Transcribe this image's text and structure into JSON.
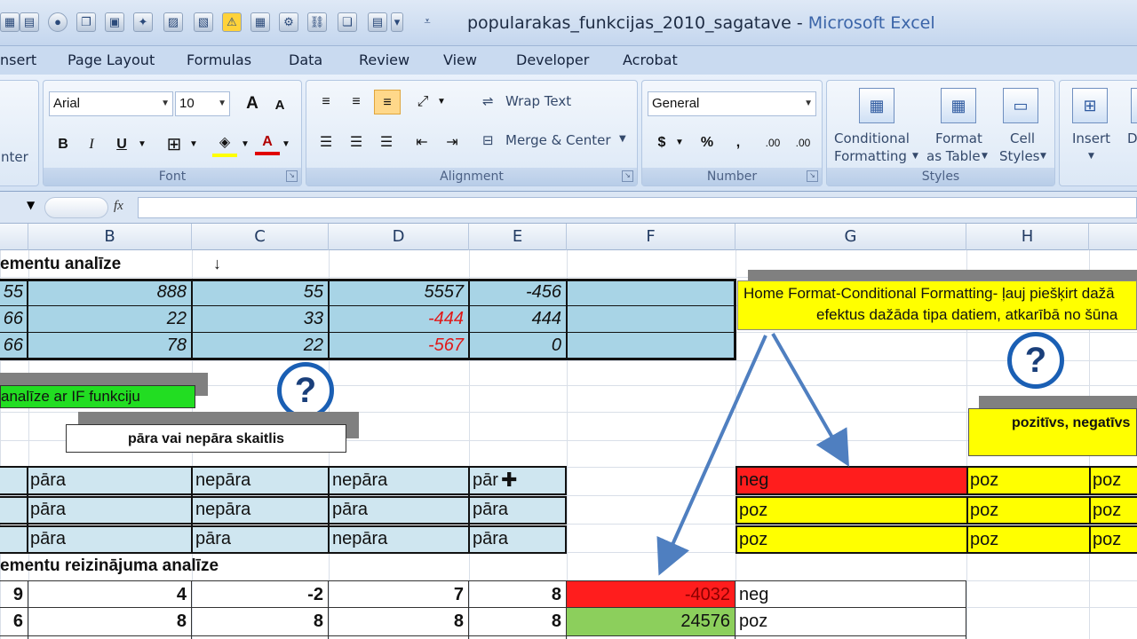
{
  "window": {
    "title": "popularakas_funkcijas_2010_sagatave",
    "separator": "-",
    "app_name": "Microsoft Excel"
  },
  "quick_access_icons": [
    "new-icon",
    "save-icon",
    "undo-icon",
    "print-icon",
    "copy-icon",
    "chart-icon",
    "warning-icon",
    "table-icon",
    "macro-icon",
    "link-icon",
    "dropdown-icon"
  ],
  "tabs": [
    "nsert",
    "Page Layout",
    "Formulas",
    "Data",
    "Review",
    "View",
    "Developer",
    "Acrobat"
  ],
  "ribbon": {
    "clipboard_tail": "nter",
    "font": {
      "name": "Arial",
      "size": "10",
      "grow": "A",
      "shrink": "A",
      "bold": "B",
      "italic": "I",
      "underline": "U",
      "font_color": "A",
      "label": "Font"
    },
    "alignment": {
      "wrap_text": "Wrap Text",
      "merge_center": "Merge & Center",
      "label": "Alignment"
    },
    "number": {
      "format": "General",
      "currency": "$",
      "percent": "%",
      "comma": ",",
      "inc_decimal": ".00",
      "dec_decimal": ".00",
      "label": "Number"
    },
    "styles": {
      "conditional": [
        "Conditional",
        "Formatting"
      ],
      "format_table": [
        "Format",
        "as Table"
      ],
      "cell_styles": [
        "Cell",
        "Styles"
      ],
      "label": "Styles"
    },
    "cells": {
      "insert": "Insert",
      "delete_partial": "D"
    }
  },
  "formula_bar": {
    "fx": "fx",
    "value": ""
  },
  "columns": [
    "B",
    "C",
    "D",
    "E",
    "F",
    "G",
    "H"
  ],
  "sheet": {
    "heading1": "ementu analīze",
    "row1": [
      "55",
      "888",
      "55",
      "5557",
      "-456"
    ],
    "row2": [
      "66",
      "22",
      "33",
      "-444",
      "444"
    ],
    "row3": [
      "66",
      "78",
      "22",
      "-567",
      "0"
    ],
    "if_label": "analīze ar IF funkciju",
    "parity_label": "pāra vai nepāra skaitlis",
    "note_line1": "Home  Format-Conditional Formatting- ļauj piešķirt dažā",
    "note_line2": "efektus dažāda tipa datiem, atkarībā no šūna",
    "pos_neg_label": "pozitīvs, negatīvs",
    "parity_rows": [
      [
        "pāra",
        "nepāra",
        "nepāra",
        "pār"
      ],
      [
        "pāra",
        "nepāra",
        "pāra",
        "pāra"
      ],
      [
        "pāra",
        "pāra",
        "nepāra",
        "pāra"
      ]
    ],
    "sign_rows": [
      [
        "neg",
        "poz",
        "poz"
      ],
      [
        "poz",
        "poz",
        "poz"
      ],
      [
        "poz",
        "poz",
        "poz"
      ]
    ],
    "heading2": "ementu reizinājuma analīze",
    "product_rows": [
      [
        "9",
        "4",
        "-2",
        "7",
        "8",
        "-4032",
        "neg"
      ],
      [
        "6",
        "8",
        "8",
        "8",
        "8",
        "24576",
        "poz"
      ]
    ]
  }
}
